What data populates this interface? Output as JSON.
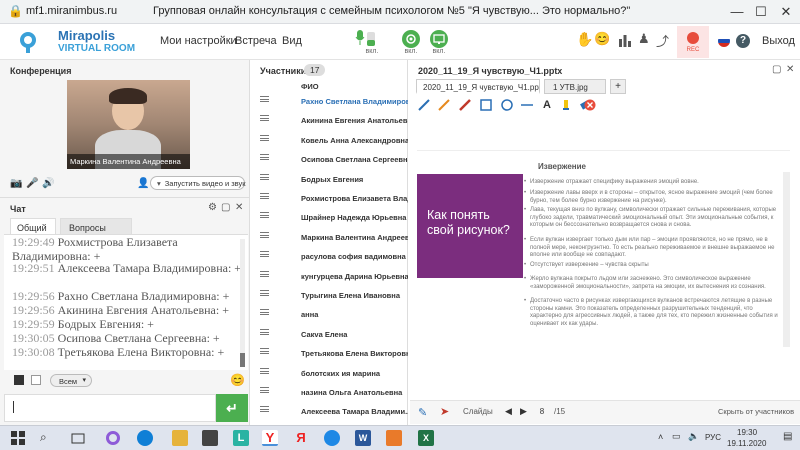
{
  "browser": {
    "url": "mf1.miranimbus.ru",
    "page_title": "Групповая онлайн консультация с семейным психологом №5 \"Я чувствую... Это нормально?\"",
    "window_controls": [
      "—",
      "☐",
      "✕"
    ]
  },
  "header": {
    "logo_line1": "Mirapolis",
    "logo_line2": "VIRTUAL ROOM",
    "menu": [
      "Мои настройки",
      "Встреча",
      "Вид"
    ],
    "mic_label": "вкл.",
    "cam_label": "вкл.",
    "screen_label": "вкл.",
    "rec_label": "REC",
    "exit_label": "Выход"
  },
  "conference": {
    "title": "Конференция",
    "video_name": "Маркина Валентина  Андреевна",
    "launch_select": "Запустить видео и звук"
  },
  "chat": {
    "title": "Чат",
    "tabs": [
      "Общий",
      "Вопросы"
    ],
    "messages": [
      {
        "time": "19:29:49",
        "text": " Рохмистрова  Елизавета  Владимировна: +"
      },
      {
        "time": "19:29:51",
        "text": " Алексеева  Тамара  Владимировна: +"
      },
      {
        "time": "19:29:56",
        "text": " Рахно Светлана  Владимировна: +"
      },
      {
        "time": "19:29:56",
        "text": " Акинина  Евгения  Анатольевна: +"
      },
      {
        "time": "19:29:59",
        "text": " Бодрых  Евгения: +"
      },
      {
        "time": "19:30:05",
        "text": " Осипова  Светлана  Сергеевна: +"
      },
      {
        "time": "19:30:08",
        "text": " Третьякова  Елена  Викторовна: +"
      }
    ],
    "recipient": "Всем",
    "input_value": "",
    "send_icon": "↵"
  },
  "participants": {
    "title": "Участники",
    "count": "17",
    "column": "ФИО",
    "names": [
      "Рахно Светлана  Владимировн",
      "Акинина  Евгения  Анатольевна",
      "Ковель Анна  Александровна",
      "Осипова  Светлана  Сергеевна",
      "Бодрых  Евгения",
      "Рохмистрова  Елизавета Владим",
      "Шрайнер Надежда  Юрьевна",
      "Маркина Валентина  Андреевн",
      "расулова  софия вадимовна",
      "кунгурцева  Дарина  Юрьевна",
      "Турыгина  Елена  Ивановна",
      "анна",
      "Сакva  Елена",
      "Третьякова  Елена Викторовна",
      "болотских ия марина",
      "назина  Ольга Анатольевна",
      "Алексеева  Тамара  Владими..."
    ]
  },
  "presentation": {
    "title": "2020_11_19_Я чувствую_Ч1.pptx",
    "tabs": [
      "2020_11_19_Я чувствую_Ч1.pptx",
      "1 УТВ.jpg"
    ],
    "add_tab": "+",
    "slide_title": "Извержение",
    "slide_question": "Как понять свой рисунок?",
    "bullets": [
      "Извержение отражает специфику выражения эмоций вовне.",
      "Извержение лавы вверх и в стороны – открытое, ясное выражение эмоций (чем более бурно, тем более бурно извержение на рисунке).",
      "Лава, текущая вниз по вулкану, символически отражает сильные переживания, которые глубоко задели, травматический эмоциональный опыт. Эти эмоциональные события, к которым он бессознательно возвращается снова и снова.",
      "Если вулкан извергает только дым или пар – эмоции проявляются, но не прямо, не в полной мере, неконгруэнтно. То есть реально переживаемое и внешне выражаемое не вполне или вообще не совпадают.",
      "Отсутствует извержение – чувства скрыты",
      "Жерло вулкана покрыто льдом или заснежено. Это символическое выражение «замороженной эмоциональности», запрета на эмоции, их вытеснения из сознания.",
      "Достаточно часто в рисунках извергающихся вулканов встречаются летящие в разные стороны камни. Это показатель определенных разрушительных тенденций, что характерно для агрессивных людей, а также для тех, кто пережил жизненные события и оценивает их как удары."
    ],
    "slides_label": "Слайды",
    "current_slide": "8",
    "total_slides": "/15",
    "hide_label": "Скрыть от участников"
  },
  "taskbar": {
    "lang": "РУС",
    "time": "19:30",
    "date": "19.11.2020"
  },
  "colors": {
    "brand_green": "#4caf50",
    "slide_purple": "#7b2d7e",
    "rec_red": "#e74c3c",
    "link_blue": "#2a6fb5"
  }
}
